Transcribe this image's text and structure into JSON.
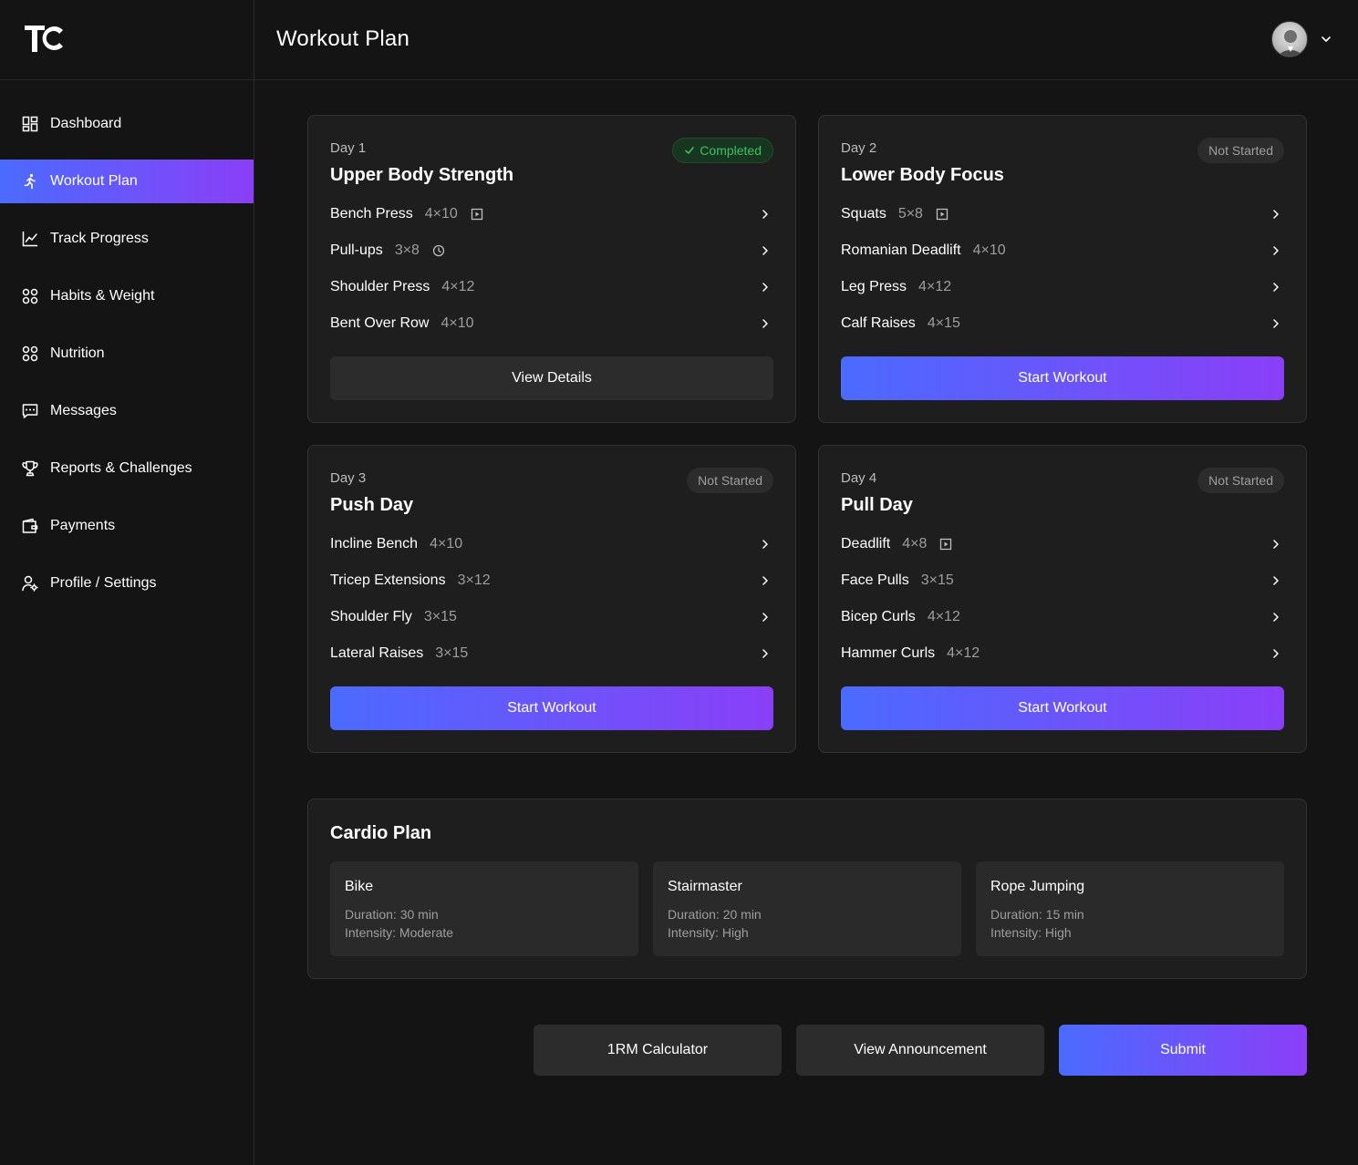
{
  "app": {
    "logo_text": "TC",
    "page_title": "Workout Plan"
  },
  "sidebar": {
    "items": [
      {
        "label": "Dashboard",
        "icon": "dashboard-grid-icon",
        "active": false
      },
      {
        "label": "Workout Plan",
        "icon": "running-figure-icon",
        "active": true
      },
      {
        "label": "Track Progress",
        "icon": "line-chart-icon",
        "active": false
      },
      {
        "label": "Habits & Weight",
        "icon": "grid-circles-icon",
        "active": false
      },
      {
        "label": "Nutrition",
        "icon": "grid-circles-icon",
        "active": false
      },
      {
        "label": "Messages",
        "icon": "message-icon",
        "active": false
      },
      {
        "label": "Reports & Challenges",
        "icon": "trophy-icon",
        "active": false
      },
      {
        "label": "Payments",
        "icon": "wallet-icon",
        "active": false
      },
      {
        "label": "Profile / Settings",
        "icon": "user-gear-icon",
        "active": false
      }
    ]
  },
  "days": [
    {
      "day": "Day 1",
      "title": "Upper Body Strength",
      "status": "Completed",
      "exercises": [
        {
          "name": "Bench Press",
          "sets": "4×10",
          "icon": "video-icon"
        },
        {
          "name": "Pull-ups",
          "sets": "3×8",
          "icon": "clock-icon"
        },
        {
          "name": "Shoulder Press",
          "sets": "4×12",
          "icon": ""
        },
        {
          "name": "Bent Over Row",
          "sets": "4×10",
          "icon": ""
        }
      ],
      "button": "View Details"
    },
    {
      "day": "Day 2",
      "title": "Lower Body Focus",
      "status": "Not Started",
      "exercises": [
        {
          "name": "Squats",
          "sets": "5×8",
          "icon": "video-icon"
        },
        {
          "name": "Romanian Deadlift",
          "sets": "4×10",
          "icon": ""
        },
        {
          "name": "Leg Press",
          "sets": "4×12",
          "icon": ""
        },
        {
          "name": "Calf Raises",
          "sets": "4×15",
          "icon": ""
        }
      ],
      "button": "Start Workout"
    },
    {
      "day": "Day 3",
      "title": "Push Day",
      "status": "Not Started",
      "exercises": [
        {
          "name": "Incline Bench",
          "sets": "4×10",
          "icon": ""
        },
        {
          "name": "Tricep Extensions",
          "sets": "3×12",
          "icon": ""
        },
        {
          "name": "Shoulder Fly",
          "sets": "3×15",
          "icon": ""
        },
        {
          "name": "Lateral Raises",
          "sets": "3×15",
          "icon": ""
        }
      ],
      "button": "Start Workout"
    },
    {
      "day": "Day 4",
      "title": "Pull Day",
      "status": "Not Started",
      "exercises": [
        {
          "name": "Deadlift",
          "sets": "4×8",
          "icon": "video-icon"
        },
        {
          "name": "Face Pulls",
          "sets": "3×15",
          "icon": ""
        },
        {
          "name": "Bicep Curls",
          "sets": "4×12",
          "icon": ""
        },
        {
          "name": "Hammer Curls",
          "sets": "4×12",
          "icon": ""
        }
      ],
      "button": "Start Workout"
    }
  ],
  "cardio": {
    "title": "Cardio Plan",
    "items": [
      {
        "name": "Bike",
        "duration": "Duration: 30 min",
        "intensity": "Intensity: Moderate"
      },
      {
        "name": "Stairmaster",
        "duration": "Duration: 20 min",
        "intensity": "Intensity: High"
      },
      {
        "name": "Rope Jumping",
        "duration": "Duration: 15 min",
        "intensity": "Intensity: High"
      }
    ]
  },
  "actions": {
    "calculator": "1RM Calculator",
    "announcement": "View Announcement",
    "submit": "Submit"
  },
  "colors": {
    "accent_start": "#4b6bff",
    "accent_end": "#8a3ff7",
    "completed": "#3fbf62",
    "background": "#141414",
    "card": "#1e1e1e"
  }
}
